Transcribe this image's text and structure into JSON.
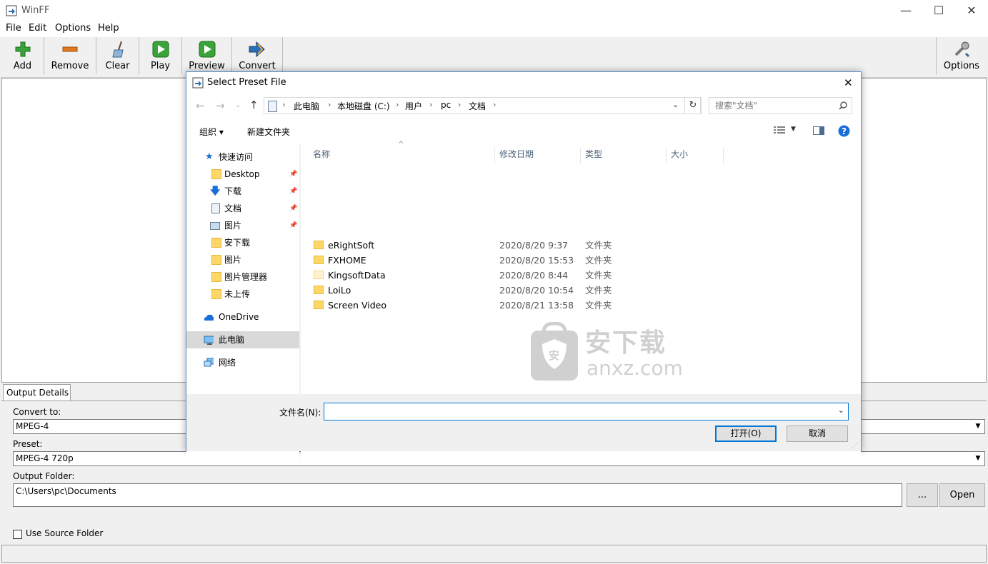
{
  "app": {
    "title": "WinFF"
  },
  "window_controls": {
    "minimize": "—",
    "maximize": "☐",
    "close": "✕"
  },
  "menu": [
    "File",
    "Edit",
    "Options",
    "Help"
  ],
  "toolbar": {
    "add": "Add",
    "remove": "Remove",
    "clear": "Clear",
    "play": "Play",
    "preview": "Preview",
    "convert": "Convert",
    "options": "Options"
  },
  "output": {
    "tab": "Output Details",
    "convert_to_label": "Convert to:",
    "convert_to_value": "MPEG-4",
    "preset_label": "Preset:",
    "preset_value": "MPEG-4 720p",
    "folder_label": "Output Folder:",
    "folder_value": "C:\\Users\\pc\\Documents",
    "browse_label": "...",
    "open_label": "Open",
    "use_source_label": "Use Source Folder"
  },
  "dialog": {
    "title": "Select Preset File",
    "close": "✕",
    "breadcrumb": [
      "此电脑",
      "本地磁盘 (C:)",
      "用户",
      "pc",
      "文档"
    ],
    "search_placeholder": "搜索\"文档\"",
    "organize": "组织 ▾",
    "new_folder": "新建文件夹",
    "columns": {
      "name": "名称",
      "date": "修改日期",
      "type": "类型",
      "size": "大小"
    },
    "nav": {
      "quick_access": "快速访问",
      "desktop": "Desktop",
      "downloads": "下载",
      "documents": "文档",
      "pictures": "图片",
      "an_download": "安下载",
      "pictures2": "图片",
      "pic_manager": "图片管理器",
      "not_uploaded": "未上传",
      "onedrive": "OneDrive",
      "this_pc": "此电脑",
      "network": "网络"
    },
    "files": [
      {
        "name": "eRightSoft",
        "date": "2020/8/20 9:37",
        "type": "文件夹"
      },
      {
        "name": "FXHOME",
        "date": "2020/8/20 15:53",
        "type": "文件夹"
      },
      {
        "name": "KingsoftData",
        "date": "2020/8/20 8:44",
        "type": "文件夹"
      },
      {
        "name": "LoiLo",
        "date": "2020/8/20 10:54",
        "type": "文件夹"
      },
      {
        "name": "Screen Video",
        "date": "2020/8/21 13:58",
        "type": "文件夹"
      }
    ],
    "filename_label": "文件名(N):",
    "filename_value": "",
    "open_button": "打开(O)",
    "cancel_button": "取消",
    "watermark": {
      "cn": "安下载",
      "en": "anxz.com",
      "badge": "安"
    }
  },
  "colors": {
    "accent": "#0078d7",
    "selected_nav": "#cce8ff",
    "folder": "#ffd766"
  }
}
